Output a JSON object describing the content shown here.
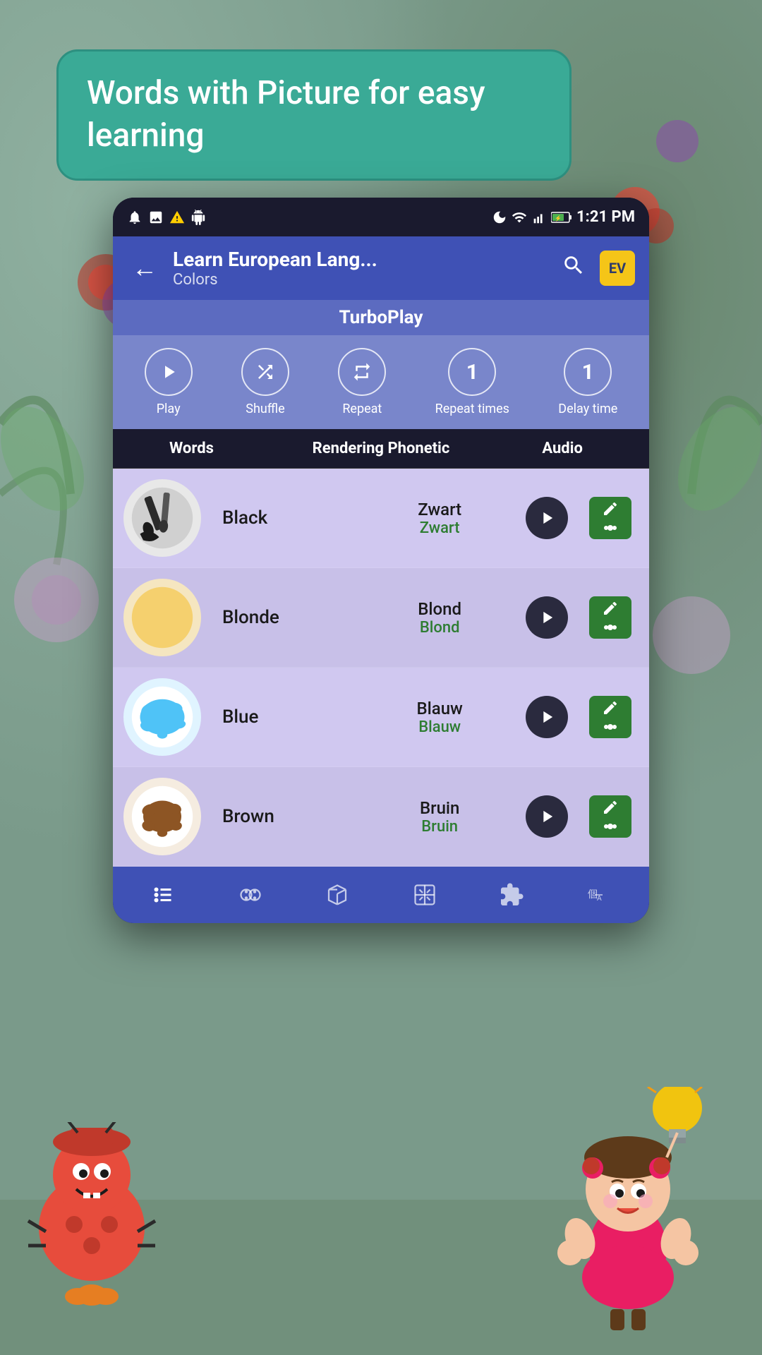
{
  "app": {
    "status_bar": {
      "time": "1:21 PM",
      "icons_left": [
        "notification",
        "image",
        "warning",
        "android"
      ],
      "icons_right": [
        "moon",
        "wifi",
        "signal",
        "battery-charging"
      ]
    },
    "title": "Learn European Lang...",
    "subtitle": "Colors",
    "search_label": "search",
    "logo_text": "EV"
  },
  "speech_bubble": {
    "text": "Words with Picture for easy learning"
  },
  "turboplay": {
    "label": "TurboPlay"
  },
  "controls": [
    {
      "id": "play",
      "label": "Play",
      "icon": "▶",
      "type": "icon"
    },
    {
      "id": "shuffle",
      "label": "Shuffle",
      "icon": "⇄",
      "type": "icon"
    },
    {
      "id": "repeat",
      "label": "Repeat",
      "icon": "↻",
      "type": "icon"
    },
    {
      "id": "repeat-times",
      "label": "Repeat times",
      "value": "1",
      "type": "number"
    },
    {
      "id": "delay-time",
      "label": "Delay time",
      "value": "1",
      "type": "number"
    }
  ],
  "table_headers": {
    "col1": "Words",
    "col2": "Rendering Phonetic",
    "col3": "Audio"
  },
  "words": [
    {
      "name": "Black",
      "phonetic": "Zwart",
      "translation": "Zwart",
      "emoji": "🖌️",
      "color": "#2a2a2a"
    },
    {
      "name": "Blonde",
      "phonetic": "Blond",
      "translation": "Blond",
      "emoji": "🟡",
      "color": "#f5d06e"
    },
    {
      "name": "Blue",
      "phonetic": "Blauw",
      "translation": "Blauw",
      "emoji": "💧",
      "color": "#4fc3f7"
    },
    {
      "name": "Brown",
      "phonetic": "Bruin",
      "translation": "Bruin",
      "emoji": "🟤",
      "color": "#8d5524"
    }
  ],
  "bottom_nav": [
    {
      "id": "list",
      "icon": "⋯",
      "label": "list",
      "active": true
    },
    {
      "id": "flashcard",
      "icon": "👁",
      "label": "flashcard",
      "active": false
    },
    {
      "id": "box",
      "icon": "📦",
      "label": "box",
      "active": false
    },
    {
      "id": "grid",
      "icon": "⊠",
      "label": "grid",
      "active": false
    },
    {
      "id": "puzzle",
      "icon": "🧩",
      "label": "puzzle",
      "active": false
    },
    {
      "id": "translate",
      "icon": "個",
      "label": "translate",
      "active": false
    }
  ],
  "colors": {
    "green_accent": "#2e7d32",
    "purple_bg": "#c8c0e8",
    "app_bar": "#3f51b5",
    "turboplay_bar": "#5c6bc0"
  }
}
